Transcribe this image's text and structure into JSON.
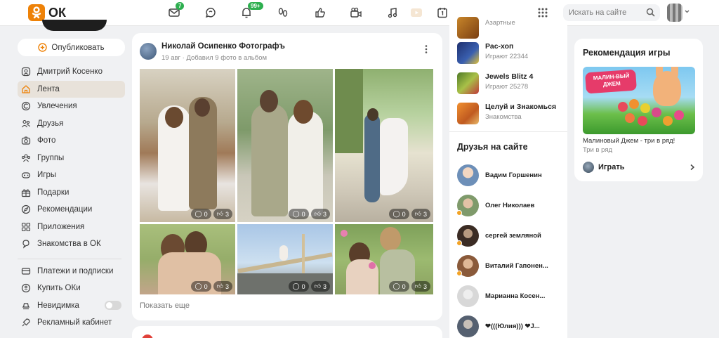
{
  "header": {
    "logo_text": "ОК",
    "badges": {
      "messages": "7",
      "notifications": "99+"
    },
    "search_placeholder": "Искать на сайте"
  },
  "sidebar": {
    "publish_label": "Опубликовать",
    "items": [
      {
        "label": "Дмитрий Косенко",
        "icon": "user-icon"
      },
      {
        "label": "Лента",
        "icon": "home-icon",
        "active": true
      },
      {
        "label": "Увлечения",
        "icon": "hobby-icon"
      },
      {
        "label": "Друзья",
        "icon": "friends-icon"
      },
      {
        "label": "Фото",
        "icon": "camera-icon"
      },
      {
        "label": "Группы",
        "icon": "groups-icon"
      },
      {
        "label": "Игры",
        "icon": "gamepad-icon"
      },
      {
        "label": "Подарки",
        "icon": "gift-icon"
      },
      {
        "label": "Рекомендации",
        "icon": "compass-icon"
      },
      {
        "label": "Приложения",
        "icon": "apps-icon"
      },
      {
        "label": "Знакомства в ОК",
        "icon": "dating-icon"
      }
    ],
    "items2": [
      {
        "label": "Платежи и подписки",
        "icon": "card-icon"
      },
      {
        "label": "Купить ОКи",
        "icon": "coin-icon"
      },
      {
        "label": "Невидимка",
        "icon": "incognito-icon",
        "toggle": false
      },
      {
        "label": "Рекламный кабинет",
        "icon": "rocket-icon"
      }
    ]
  },
  "post": {
    "author": "Николай Осипенко Фотографъ",
    "meta": "19 авг · Добавил 9 фото в альбом",
    "photos": [
      {
        "comments": "0",
        "likes": "3"
      },
      {
        "comments": "0",
        "likes": "3"
      },
      {
        "comments": "0",
        "likes": "3"
      },
      {
        "comments": "0",
        "likes": "3"
      },
      {
        "comments": "0",
        "likes": "3"
      },
      {
        "comments": "0",
        "likes": "3"
      }
    ],
    "show_more": "Показать еще"
  },
  "games": [
    {
      "name": "",
      "sub": "Азартные",
      "color": "#b8741f"
    },
    {
      "name": "Рас-хоп",
      "sub": "Играют 22344",
      "color": "#243a7a"
    },
    {
      "name": "Jewels Blitz 4",
      "sub": "Играют 25278",
      "color": "#6b8a2e"
    },
    {
      "name": "Целуй и Знакомься",
      "sub": "Знакомства",
      "color": "#e07a2f"
    }
  ],
  "friends": {
    "title": "Друзья на сайте",
    "list": [
      {
        "name": "Вадим Горшенин",
        "color": "#6d8fb8"
      },
      {
        "name": "Олег Николаев",
        "color": "#7f9a6b"
      },
      {
        "name": "сергей земляной",
        "color": "#3b2c24"
      },
      {
        "name": "Виталий Гапонен...",
        "color": "#8a5a3a"
      },
      {
        "name": "Марианна Косен...",
        "color": "#d8d8d8"
      },
      {
        "name": "❤(((Юлия))) ❤J...",
        "color": "#556070"
      }
    ]
  },
  "game_rec": {
    "title": "Рекомендация игры",
    "banner_text": "МАЛИН-ВЫЙ ДЖЕМ",
    "game_title": "Малиновый Джем - три в ряд!",
    "game_sub": "Три в ряд",
    "play_label": "Играть"
  }
}
